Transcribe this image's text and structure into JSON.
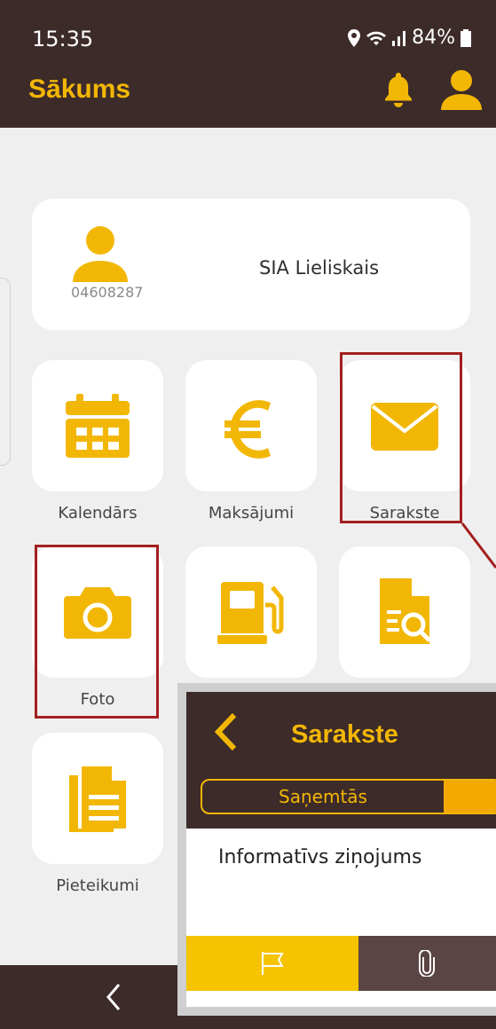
{
  "status_bar": {
    "time": "15:35",
    "battery": "84%"
  },
  "header": {
    "title": "Sākums"
  },
  "profile": {
    "code": "04608287",
    "company": "SIA Lieliskais"
  },
  "tiles": [
    {
      "label": "Kalendārs",
      "icon": "calendar-icon"
    },
    {
      "label": "Maksājumi",
      "icon": "euro-icon"
    },
    {
      "label": "Sarakste",
      "icon": "envelope-icon"
    },
    {
      "label": "Foto",
      "icon": "camera-icon"
    },
    {
      "label": "",
      "icon": "fuel-icon"
    },
    {
      "label": "",
      "icon": "document-search-icon"
    },
    {
      "label": "Pieteikumi",
      "icon": "documents-icon"
    }
  ],
  "inset": {
    "title": "Sarakste",
    "tab_received": "Saņemtās",
    "message_subject": "Informatīvs ziņojums"
  },
  "colors": {
    "brand_dark": "#3d2b2a",
    "accent": "#f2b705",
    "highlight": "#a31f1f"
  }
}
